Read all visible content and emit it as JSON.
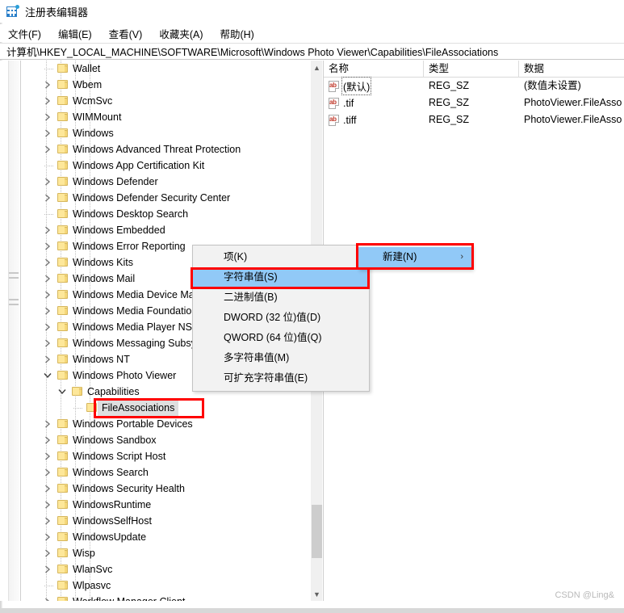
{
  "window": {
    "title": "注册表编辑器",
    "icon": "registry-editor-icon"
  },
  "menubar": {
    "items": [
      {
        "label": "文件(F)"
      },
      {
        "label": "编辑(E)"
      },
      {
        "label": "查看(V)"
      },
      {
        "label": "收藏夹(A)"
      },
      {
        "label": "帮助(H)"
      }
    ]
  },
  "address": {
    "path": "计算机\\HKEY_LOCAL_MACHINE\\SOFTWARE\\Microsoft\\Windows Photo Viewer\\Capabilities\\FileAssociations"
  },
  "tree": {
    "items": [
      {
        "label": "Wallet",
        "depth": 1,
        "expander": "none"
      },
      {
        "label": "Wbem",
        "depth": 1,
        "expander": "collapsed"
      },
      {
        "label": "WcmSvc",
        "depth": 1,
        "expander": "collapsed"
      },
      {
        "label": "WIMMount",
        "depth": 1,
        "expander": "collapsed"
      },
      {
        "label": "Windows",
        "depth": 1,
        "expander": "collapsed"
      },
      {
        "label": "Windows Advanced Threat Protection",
        "depth": 1,
        "expander": "collapsed"
      },
      {
        "label": "Windows App Certification Kit",
        "depth": 1,
        "expander": "none"
      },
      {
        "label": "Windows Defender",
        "depth": 1,
        "expander": "collapsed"
      },
      {
        "label": "Windows Defender Security Center",
        "depth": 1,
        "expander": "collapsed"
      },
      {
        "label": "Windows Desktop Search",
        "depth": 1,
        "expander": "none"
      },
      {
        "label": "Windows Embedded",
        "depth": 1,
        "expander": "collapsed"
      },
      {
        "label": "Windows Error Reporting",
        "depth": 1,
        "expander": "collapsed"
      },
      {
        "label": "Windows Kits",
        "depth": 1,
        "expander": "collapsed"
      },
      {
        "label": "Windows Mail",
        "depth": 1,
        "expander": "collapsed"
      },
      {
        "label": "Windows Media Device Manager",
        "depth": 1,
        "expander": "collapsed"
      },
      {
        "label": "Windows Media Foundation",
        "depth": 1,
        "expander": "collapsed"
      },
      {
        "label": "Windows Media Player NSS",
        "depth": 1,
        "expander": "collapsed"
      },
      {
        "label": "Windows Messaging Subsystem",
        "depth": 1,
        "expander": "collapsed"
      },
      {
        "label": "Windows NT",
        "depth": 1,
        "expander": "collapsed"
      },
      {
        "label": "Windows Photo Viewer",
        "depth": 1,
        "expander": "expanded"
      },
      {
        "label": "Capabilities",
        "depth": 2,
        "expander": "expanded"
      },
      {
        "label": "FileAssociations",
        "depth": 3,
        "expander": "none",
        "selected": true
      },
      {
        "label": "Windows Portable Devices",
        "depth": 1,
        "expander": "collapsed"
      },
      {
        "label": "Windows Sandbox",
        "depth": 1,
        "expander": "collapsed"
      },
      {
        "label": "Windows Script Host",
        "depth": 1,
        "expander": "collapsed"
      },
      {
        "label": "Windows Search",
        "depth": 1,
        "expander": "collapsed"
      },
      {
        "label": "Windows Security Health",
        "depth": 1,
        "expander": "collapsed"
      },
      {
        "label": "WindowsRuntime",
        "depth": 1,
        "expander": "collapsed"
      },
      {
        "label": "WindowsSelfHost",
        "depth": 1,
        "expander": "collapsed"
      },
      {
        "label": "WindowsUpdate",
        "depth": 1,
        "expander": "collapsed"
      },
      {
        "label": "Wisp",
        "depth": 1,
        "expander": "collapsed"
      },
      {
        "label": "WlanSvc",
        "depth": 1,
        "expander": "collapsed"
      },
      {
        "label": "Wlpasvc",
        "depth": 1,
        "expander": "none"
      },
      {
        "label": "Workflow Manager Client",
        "depth": 1,
        "expander": "collapsed"
      }
    ]
  },
  "values": {
    "columns": [
      "名称",
      "类型",
      "数据"
    ],
    "rows": [
      {
        "name": "(默认)",
        "type": "REG_SZ",
        "data": "(数值未设置)",
        "icon": "string-value-icon",
        "focused": true
      },
      {
        "name": ".tif",
        "type": "REG_SZ",
        "data": "PhotoViewer.FileAsso",
        "icon": "string-value-icon"
      },
      {
        "name": ".tiff",
        "type": "REG_SZ",
        "data": "PhotoViewer.FileAsso",
        "icon": "string-value-icon"
      }
    ]
  },
  "context_menu": {
    "items": [
      {
        "label": "项(K)",
        "highlighted": false
      },
      {
        "label": "字符串值(S)",
        "highlighted": true
      },
      {
        "label": "二进制值(B)",
        "highlighted": false
      },
      {
        "label": "DWORD (32 位)值(D)",
        "highlighted": false
      },
      {
        "label": "QWORD (64 位)值(Q)",
        "highlighted": false
      },
      {
        "label": "多字符串值(M)",
        "highlighted": false
      },
      {
        "label": "可扩充字符串值(E)",
        "highlighted": false
      }
    ]
  },
  "submenu_parent": {
    "label": "新建(N)",
    "arrow": "›",
    "highlighted": true
  },
  "watermark": {
    "text": "CSDN @Ling&"
  },
  "colors": {
    "highlight": "#91c9f7",
    "annotation": "#ff0000",
    "selection": "#dededf",
    "folder": "#fde79a"
  }
}
